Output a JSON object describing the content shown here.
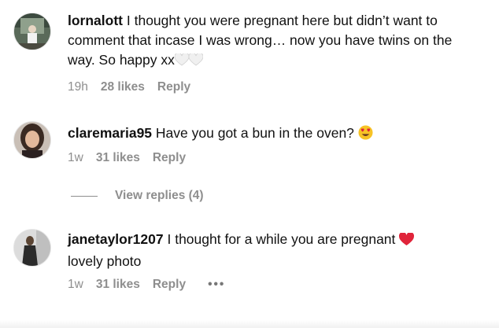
{
  "comments": [
    {
      "username": "lornalott",
      "text": "I thought you were pregnant here but didn’t want to comment that incase I was wrong… now you have twins on the way. So happy xx",
      "emoji": "white-heart-icon",
      "time": "19h",
      "likes": "28 likes",
      "reply": "Reply"
    },
    {
      "username": "claremaria95",
      "text": "Have you got a bun in the oven?",
      "emoji": "heart-eyes-emoji-icon",
      "time": "1w",
      "likes": "31 likes",
      "reply": "Reply",
      "view_replies": "View replies (4)"
    },
    {
      "username": "janetaylor1207",
      "text": "I thought for a while you are pregnant",
      "text_after": "lovely photo",
      "emoji": "red-heart-icon",
      "time": "1w",
      "likes": "31 likes",
      "reply": "Reply",
      "more": "•••"
    }
  ],
  "colors": {
    "text": "#111111",
    "meta": "#8e8e8e",
    "heart_red": "#e0243a"
  }
}
